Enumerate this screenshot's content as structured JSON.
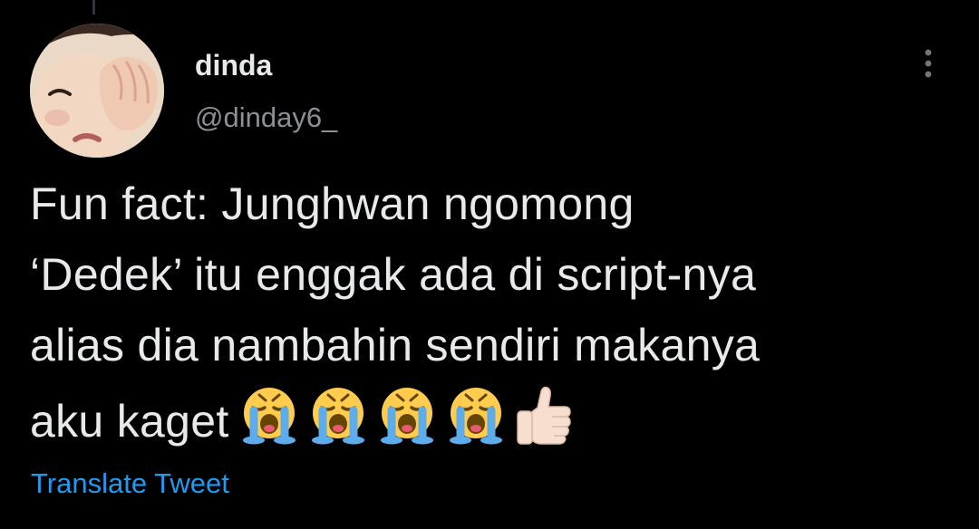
{
  "tweet": {
    "author": {
      "display_name": "dinda",
      "handle": "@dinday6_"
    },
    "text_lines": [
      "Fun fact: Junghwan ngomong",
      "‘Dedek’ itu enggak ada di script-nya",
      "alias dia nambahin sendiri makanya",
      "aku kaget"
    ],
    "emojis": [
      "loudly-crying-face",
      "loudly-crying-face",
      "loudly-crying-face",
      "loudly-crying-face",
      "thumbs-up-light-skin-tone"
    ],
    "translate_label": "Translate Tweet"
  },
  "colors": {
    "background": "#000000",
    "text_primary": "#e7e9ea",
    "text_secondary": "#8b9096",
    "link_accent": "#1d9bf0"
  },
  "icons": {
    "more": "more-horizontal-icon"
  }
}
